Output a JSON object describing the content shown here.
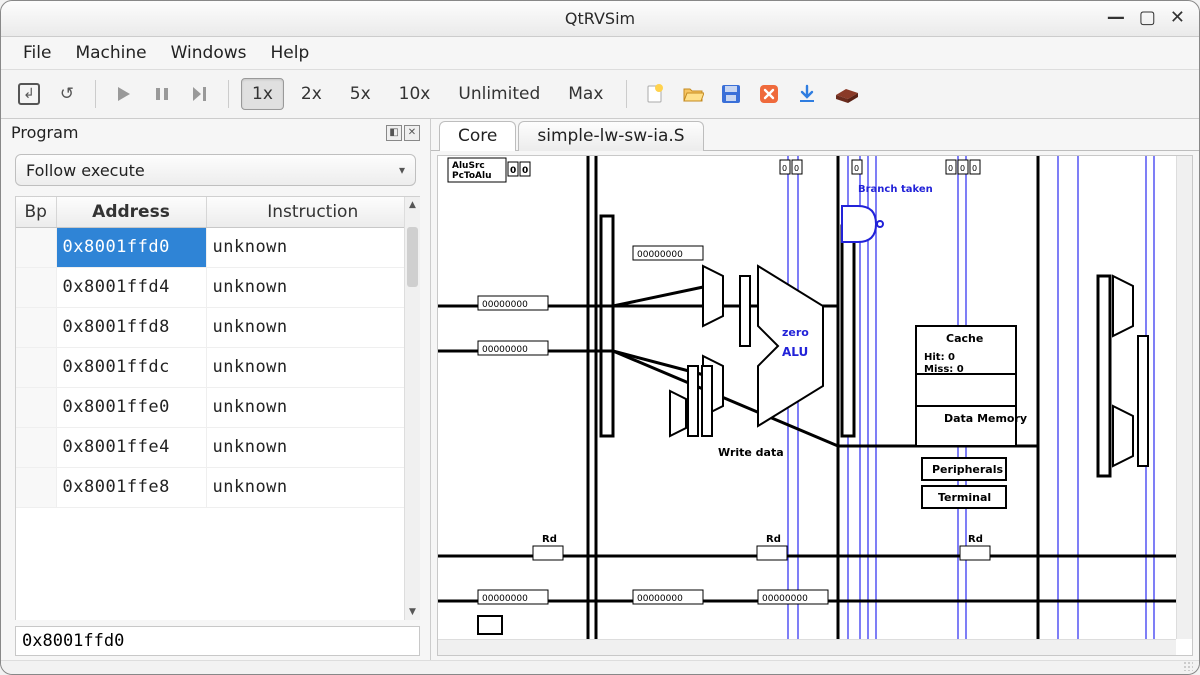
{
  "window": {
    "title": "QtRVSim"
  },
  "menu": {
    "file": "File",
    "machine": "Machine",
    "windows": "Windows",
    "help": "Help"
  },
  "toolbar": {
    "speed": {
      "x1": "1x",
      "x2": "2x",
      "x5": "5x",
      "x10": "10x",
      "unlimited": "Unlimited",
      "max": "Max"
    }
  },
  "program": {
    "title": "Program",
    "follow_label": "Follow execute",
    "columns": {
      "bp": "Bp",
      "address": "Address",
      "instruction": "Instruction"
    },
    "rows": [
      {
        "addr": "0x8001ffd0",
        "instr": "unknown",
        "selected": true
      },
      {
        "addr": "0x8001ffd4",
        "instr": "unknown",
        "selected": false
      },
      {
        "addr": "0x8001ffd8",
        "instr": "unknown",
        "selected": false
      },
      {
        "addr": "0x8001ffdc",
        "instr": "unknown",
        "selected": false
      },
      {
        "addr": "0x8001ffe0",
        "instr": "unknown",
        "selected": false
      },
      {
        "addr": "0x8001ffe4",
        "instr": "unknown",
        "selected": false
      },
      {
        "addr": "0x8001ffe8",
        "instr": "unknown",
        "selected": false
      }
    ],
    "address_input": "0x8001ffd0"
  },
  "tabs": {
    "core": "Core",
    "source": "simple-lw-sw-ia.S"
  },
  "diagram": {
    "branch_taken": "Branch\ntaken",
    "zero": "zero",
    "alu": "ALU",
    "write_data": "Write data",
    "cache": "Cache",
    "hit": "Hit: 0",
    "miss": "Miss: 0",
    "data_memory": "Data\nMemory",
    "peripherals": "Peripherals",
    "terminal": "Terminal",
    "rd": "Rd",
    "alusrc": "AluSrc",
    "pctoalu": "PcToAlu",
    "zeros": "00000000"
  }
}
